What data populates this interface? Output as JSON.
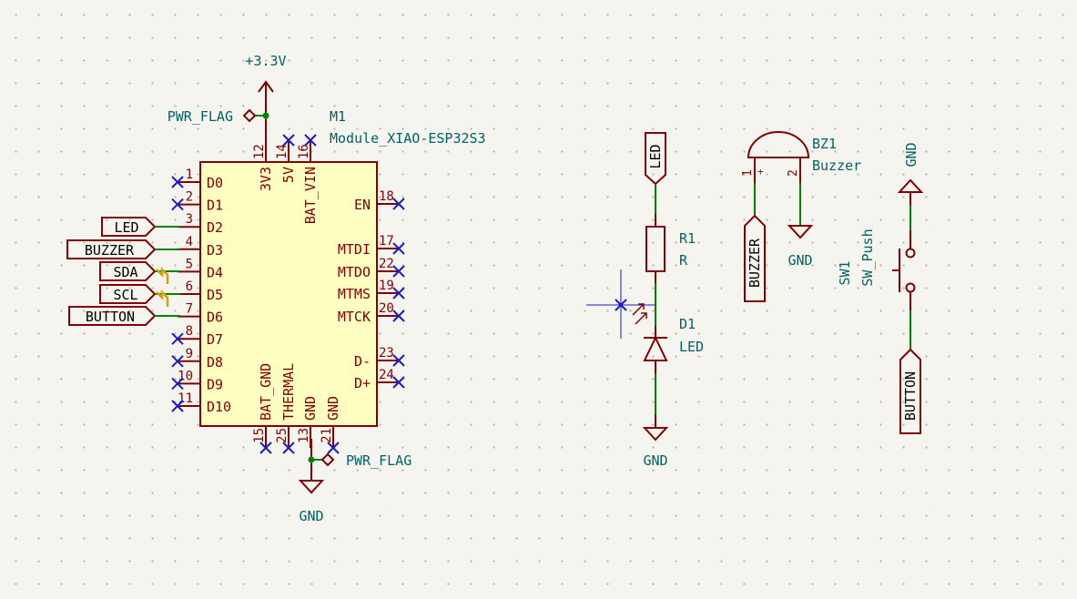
{
  "colors": {
    "background": "#f5f4ef",
    "component_outline": "#840000",
    "component_fill": "#ffffc2",
    "wire": "#008400",
    "net_label_text": "#000000",
    "field_text": "#006464",
    "no_connect": "#1d1dc2",
    "junction": "#008400",
    "warning_marker": "#d4a017"
  },
  "power": {
    "v33": "+3.3V",
    "gnd_main": "GND",
    "pwr_flag_top": "PWR_FLAG",
    "pwr_flag_bottom": "PWR_FLAG",
    "gnd_led": "GND",
    "gnd_buzzer": "GND",
    "gnd_switch": "GND"
  },
  "module": {
    "ref": "M1",
    "value": "Module_XIAO-ESP32S3",
    "left_pins": [
      {
        "num": "1",
        "name": "D0"
      },
      {
        "num": "2",
        "name": "D1"
      },
      {
        "num": "3",
        "name": "D2"
      },
      {
        "num": "4",
        "name": "D3"
      },
      {
        "num": "5",
        "name": "D4"
      },
      {
        "num": "6",
        "name": "D5"
      },
      {
        "num": "7",
        "name": "D6"
      },
      {
        "num": "8",
        "name": "D7"
      },
      {
        "num": "9",
        "name": "D8"
      },
      {
        "num": "10",
        "name": "D9"
      },
      {
        "num": "11",
        "name": "D10"
      }
    ],
    "right_pins": [
      {
        "num": "18",
        "name": "EN"
      },
      {
        "num": "17",
        "name": "MTDI"
      },
      {
        "num": "22",
        "name": "MTDO"
      },
      {
        "num": "19",
        "name": "MTMS"
      },
      {
        "num": "20",
        "name": "MTCK"
      },
      {
        "num": "23",
        "name": "D-"
      },
      {
        "num": "24",
        "name": "D+"
      }
    ],
    "top_pins": [
      {
        "num": "12",
        "name": "3V3"
      },
      {
        "num": "14",
        "name": "5V"
      },
      {
        "num": "16",
        "name": "BAT_VIN"
      }
    ],
    "bottom_pins": [
      {
        "num": "15",
        "name": "BAT_GND"
      },
      {
        "num": "25",
        "name": "THERMAL"
      },
      {
        "num": "13",
        "name": "GND"
      },
      {
        "num": "21",
        "name": "GND"
      }
    ]
  },
  "net_labels": {
    "led": "LED",
    "buzzer": "BUZZER",
    "sda": "SDA",
    "scl": "SCL",
    "button": "BUTTON",
    "led_right": "LED",
    "buzzer_right": "BUZZER",
    "button_right": "BUTTON"
  },
  "resistor": {
    "ref": "R1",
    "value": "R"
  },
  "led": {
    "ref": "D1",
    "value": "LED"
  },
  "buzzer": {
    "ref": "BZ1",
    "value": "Buzzer",
    "pin1": "1",
    "pin2": "2",
    "plus": "+"
  },
  "switch": {
    "ref": "SW1",
    "value": "SW_Push"
  }
}
